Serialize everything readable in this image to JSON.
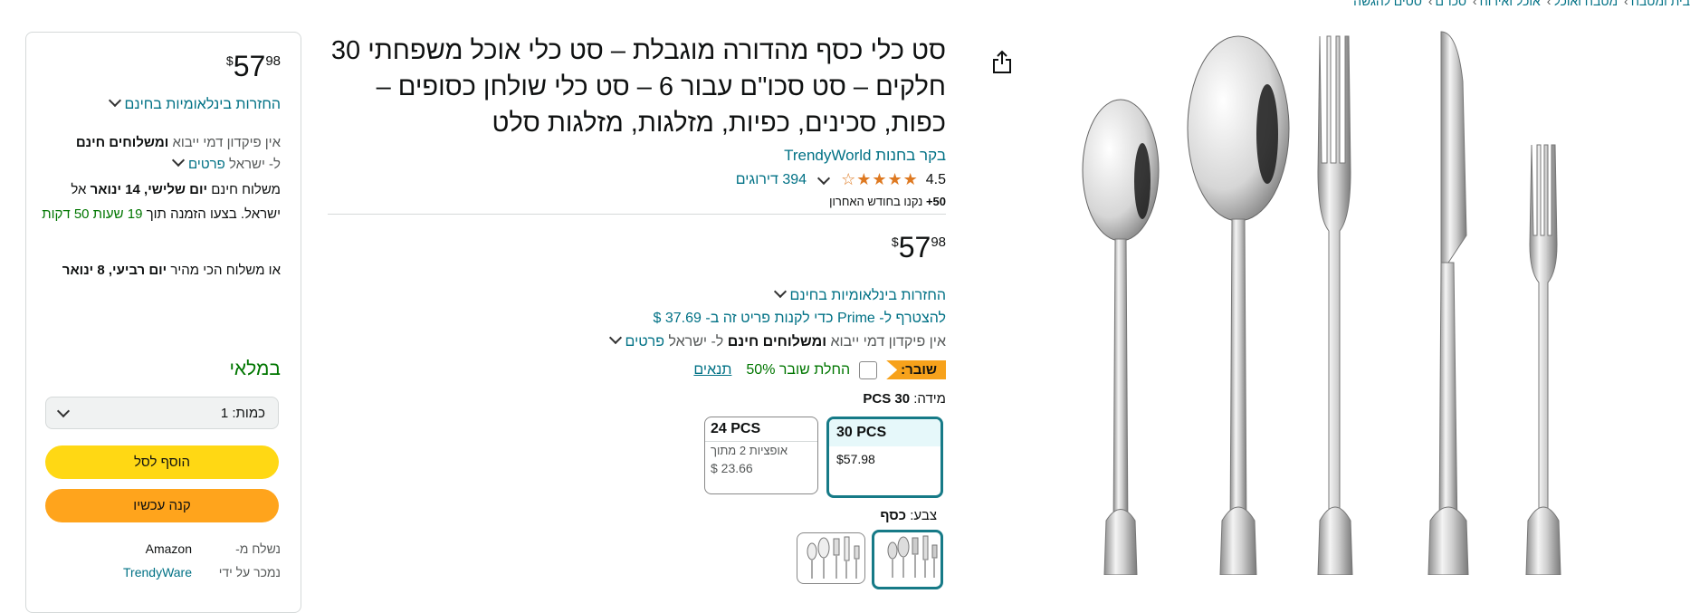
{
  "breadcrumb": [
    "בית ומטבח",
    "מטבח ואוכל",
    "אוכל ואירוח",
    "סכו\"ם",
    "סטים להגשה"
  ],
  "gallery": {
    "share_icon": "share-icon",
    "image": "cutlery-set-image"
  },
  "product": {
    "title": "סט כלי כסף מהדורה מוגבלת – סט כלי אוכל משפחתי 30 חלקים – סט סכו\"ם עבור 6 – סט כלי שולחן כסופים – כפות, סכינים, כפיות, מזלגות, מזלגות סלט",
    "store_link": "בקר בחנות TrendyWorld",
    "rating_value": "4.5",
    "rating_count": "394 דירוגים",
    "bought_bold": "50+",
    "bought_rest": " נקנו בחודש האחרון",
    "price_symbol": "$",
    "price_whole": "57",
    "price_fraction": "98",
    "returns": "החזרות בינלאומיות בחינם",
    "prime": "להצטרף ל- Prime כדי לקנות פריט זה ב- 37.69 $",
    "shipping_prefix": "אין פיקדון דמי ייבוא",
    "shipping_bold": "ומשלוחים חינם",
    "shipping_suffix": "ל- ישראל",
    "details_link": "פרטים",
    "coupon_badge": "שובר:",
    "coupon_text": "החלת שובר 50%",
    "coupon_terms": "תנאים",
    "size_label": "מידה:",
    "size_value": "30 PCS",
    "sizes": [
      {
        "name": "30 PCS",
        "price": "$57.98"
      },
      {
        "name": "24 PCS",
        "sub": "אופציות 2 מתוך",
        "price": "$ 23.66"
      }
    ],
    "color_label": "צבע:",
    "color_value": "כסף"
  },
  "buybox": {
    "price_symbol": "$",
    "price_whole": "57",
    "price_fraction": "98",
    "returns": "החזרות בינלאומיות בחינם",
    "import_prefix": "אין פיקדון דמי ייבוא",
    "import_bold": "ומשלוחים חינם",
    "import_line2": "ל- ישראל",
    "details_link": "פרטים",
    "delivery_prefix": "משלוח חינם",
    "delivery_date": "יום שלישי, 14 ינואר",
    "delivery_to": "אל ישראל. בצעו הזמנה תוך",
    "delivery_countdown": "19 שעות 50 דקות",
    "fastest_prefix": "או משלוח הכי מהיר",
    "fastest_date": "יום רביעי, 8 ינואר",
    "in_stock": "במלאי",
    "qty_label": "כמות:",
    "qty_value": "1",
    "add_to_cart": "הוסף לסל",
    "buy_now": "קנה עכשיו",
    "ships_from_label": "נשלח מ-",
    "ships_from_value": "Amazon",
    "sold_by_label": "נמכר על ידי",
    "sold_by_value": "TrendyWare"
  },
  "colors": {
    "link": "#007185",
    "star": "#de7921",
    "cart": "#ffd814",
    "buy": "#ffa41c",
    "badge": "#f7a21b",
    "green": "#007600",
    "selected": "#167a87"
  }
}
